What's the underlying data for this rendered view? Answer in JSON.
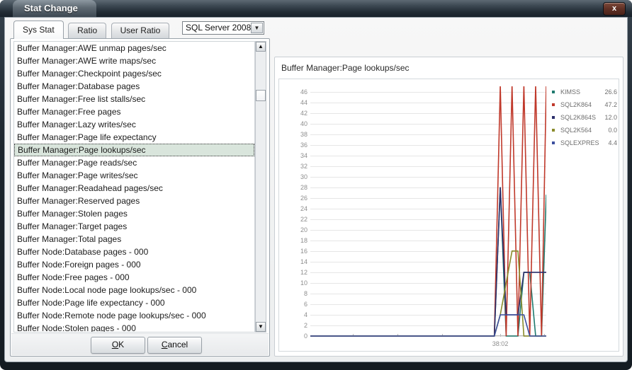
{
  "window": {
    "title": "Stat Change",
    "close_label": "x"
  },
  "tabs": [
    {
      "label": "Sys Stat",
      "active": true
    },
    {
      "label": "Ratio",
      "active": false
    },
    {
      "label": "User Ratio",
      "active": false
    }
  ],
  "server_select": {
    "value": "SQL Server 2008",
    "arrow": "▼"
  },
  "counter_list": {
    "selected": "Buffer Manager:Page lookups/sec",
    "items": [
      "Buffer Manager:AWE unmap pages/sec",
      "Buffer Manager:AWE write maps/sec",
      "Buffer Manager:Checkpoint pages/sec",
      "Buffer Manager:Database pages",
      "Buffer Manager:Free list stalls/sec",
      "Buffer Manager:Free pages",
      "Buffer Manager:Lazy writes/sec",
      "Buffer Manager:Page life expectancy",
      "Buffer Manager:Page lookups/sec",
      "Buffer Manager:Page reads/sec",
      "Buffer Manager:Page writes/sec",
      "Buffer Manager:Readahead pages/sec",
      "Buffer Manager:Reserved pages",
      "Buffer Manager:Stolen pages",
      "Buffer Manager:Target pages",
      "Buffer Manager:Total pages",
      "Buffer Node:Database pages - 000",
      "Buffer Node:Foreign pages - 000",
      "Buffer Node:Free pages - 000",
      "Buffer Node:Local node page lookups/sec - 000",
      "Buffer Node:Page life expectancy - 000",
      "Buffer Node:Remote node page lookups/sec - 000",
      "Buffer Node:Stolen pages - 000"
    ]
  },
  "scrollbar": {
    "up_arrow": "▲",
    "down_arrow": "▼"
  },
  "buttons": {
    "ok": "OK",
    "ok_accel": "O",
    "ok_rest": "K",
    "cancel_accel": "C",
    "cancel_rest": "ancel"
  },
  "chart_data": {
    "type": "line",
    "title": "Buffer Manager:Page lookups/sec",
    "xlabel": "",
    "ylabel": "",
    "ylim": [
      0,
      47
    ],
    "yticks": [
      0,
      2,
      4,
      6,
      8,
      10,
      12,
      14,
      16,
      18,
      20,
      22,
      24,
      26,
      28,
      30,
      32,
      34,
      36,
      38,
      40,
      42,
      44,
      46
    ],
    "xticks": [
      "38:02"
    ],
    "xtick_positions": [
      0.805
    ],
    "grid": true,
    "legend_position": "right",
    "x": [
      0,
      0.1,
      0.2,
      0.3,
      0.4,
      0.5,
      0.6,
      0.7,
      0.78,
      0.805,
      0.83,
      0.855,
      0.88,
      0.905,
      0.93,
      0.955,
      0.98,
      1.0
    ],
    "series": [
      {
        "name": "KIMSS",
        "value": "26.6",
        "color": "#1f7a6e",
        "values": [
          0,
          0,
          0,
          0,
          0,
          0,
          0,
          0,
          0,
          28,
          0,
          0,
          0,
          12,
          12,
          0,
          0,
          26.6
        ]
      },
      {
        "name": "SQL2K864",
        "value": "47.2",
        "color": "#c0392b",
        "values": [
          0,
          0,
          0,
          0,
          0,
          0,
          0,
          0,
          0,
          47.2,
          0,
          47.2,
          0,
          47.2,
          0,
          47.2,
          0,
          47.2
        ]
      },
      {
        "name": "SQL2K864S",
        "value": "12.0",
        "color": "#2b2f6b",
        "values": [
          0,
          0,
          0,
          0,
          0,
          0,
          0,
          0,
          0,
          28,
          4,
          4,
          4,
          12,
          12,
          12,
          12,
          12
        ]
      },
      {
        "name": "SQL2K564",
        "value": "0.0",
        "color": "#8a8b2a",
        "values": [
          0,
          0,
          0,
          0,
          0,
          0,
          0,
          0,
          0,
          4,
          10,
          16,
          16,
          0,
          0,
          0,
          0,
          0
        ]
      },
      {
        "name": "SQLEXPRES",
        "value": "4.4",
        "color": "#3b4f9e",
        "values": [
          0,
          0,
          0,
          0,
          0,
          0,
          0,
          0,
          0,
          4,
          4,
          4,
          4,
          4,
          0,
          0,
          0,
          0
        ]
      }
    ]
  }
}
